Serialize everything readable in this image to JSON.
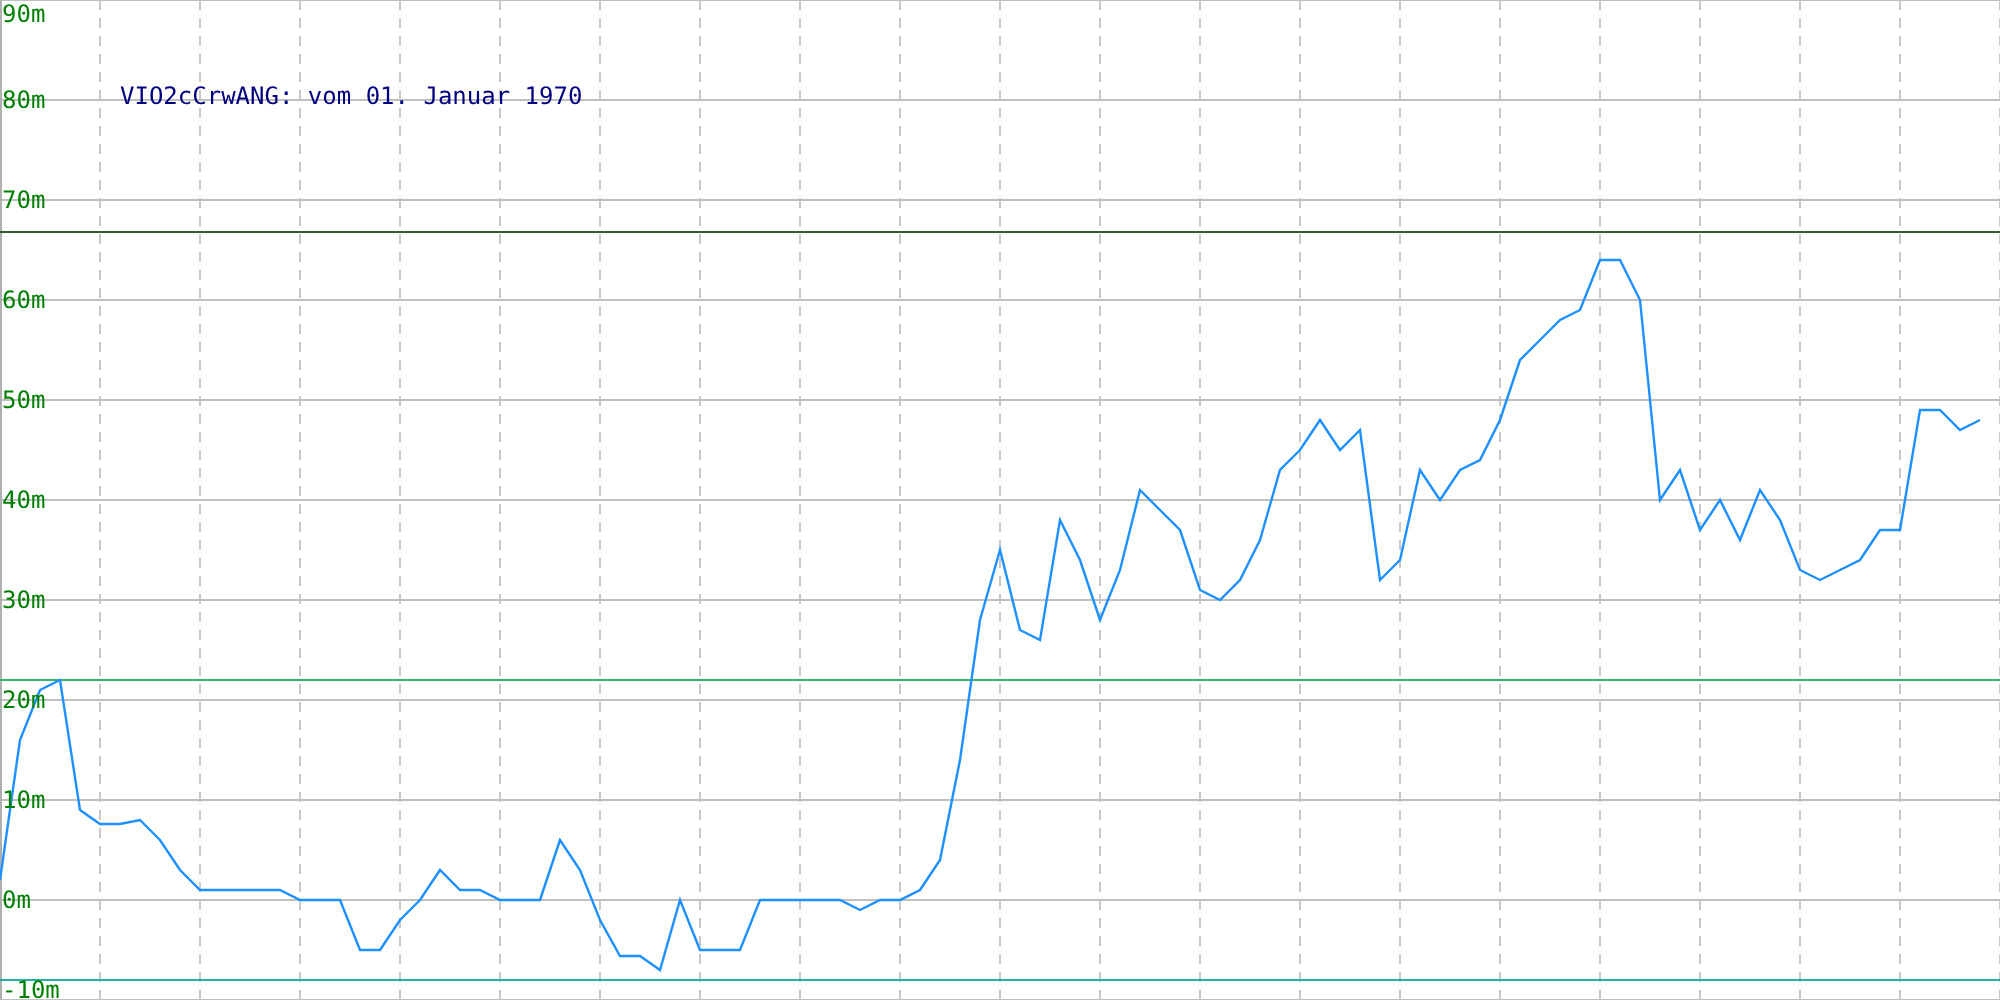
{
  "chart_data": {
    "type": "line",
    "title": "VIO2cCrwANG: vom 01. Januar 1970",
    "ylim": [
      -10,
      90
    ],
    "grid": true,
    "yticks": [
      {
        "value": -10,
        "label": "-10m"
      },
      {
        "value": 0,
        "label": "0m"
      },
      {
        "value": 10,
        "label": "10m"
      },
      {
        "value": 20,
        "label": "20m"
      },
      {
        "value": 30,
        "label": "30m"
      },
      {
        "value": 40,
        "label": "40m"
      },
      {
        "value": 50,
        "label": "50m"
      },
      {
        "value": 60,
        "label": "60m"
      },
      {
        "value": 70,
        "label": "70m"
      },
      {
        "value": 80,
        "label": "80m"
      },
      {
        "value": 90,
        "label": "90m"
      }
    ],
    "series": [
      {
        "color": "#1e90ff",
        "values": [
          2,
          16,
          21,
          22,
          9,
          7.6,
          7.6,
          8,
          6,
          3,
          1,
          1,
          1,
          1,
          1,
          0,
          0,
          0,
          -5,
          -5,
          -2,
          0,
          3,
          1,
          1,
          0,
          0,
          0,
          6,
          3,
          -2,
          -5.6,
          -5.6,
          -7,
          0,
          -5,
          -5,
          -5,
          0,
          0,
          0,
          0,
          0,
          -1,
          0,
          0,
          1,
          4,
          14,
          28,
          35,
          27,
          26,
          38,
          34,
          28,
          33,
          41,
          39,
          37,
          31,
          30,
          32,
          36,
          43,
          45,
          48,
          45,
          47,
          32,
          34,
          43,
          40,
          43,
          44,
          48,
          54,
          56,
          58,
          59,
          64,
          64,
          60,
          40,
          43,
          37,
          40,
          36,
          41,
          38,
          33,
          32,
          33,
          34,
          37,
          37,
          49,
          49,
          47,
          48
        ]
      }
    ],
    "ref_lines": [
      {
        "axis": "y",
        "value": 66.8,
        "color": "#2f5f2f"
      },
      {
        "axis": "y",
        "value": 22,
        "color": "#3cb371"
      },
      {
        "axis": "y",
        "value": -8,
        "color": "#20b2aa"
      }
    ]
  }
}
